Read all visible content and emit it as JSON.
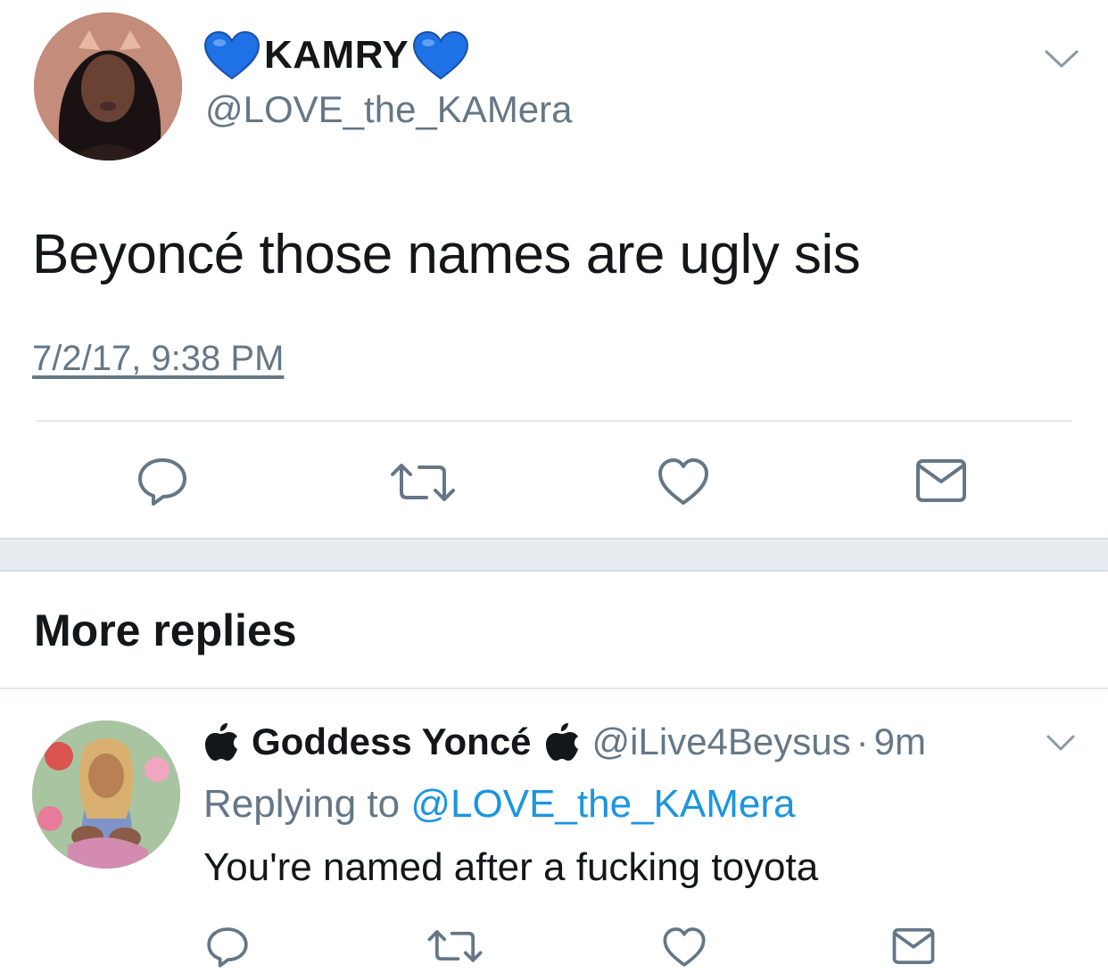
{
  "tweet": {
    "display_name": "KAMRY",
    "handle": "@LOVE_the_KAMera",
    "text": "Beyoncé those names are ugly sis",
    "timestamp": "7/2/17, 9:38 PM"
  },
  "more_replies": {
    "title": "More replies"
  },
  "reply": {
    "display_name": "Goddess Yoncé",
    "handle": "@iLive4Beysus",
    "separator": "·",
    "time_ago": "9m",
    "replying_prefix": "Replying to",
    "replying_to": "@LOVE_the_KAMera",
    "text": "You're named after a fucking toyota"
  },
  "icons": {
    "reply": "reply-icon",
    "retweet": "retweet-icon",
    "like": "like-icon",
    "dm": "direct-message-icon",
    "chevron": "chevron-down-icon",
    "name_emoji": "blue-heart-icon",
    "reply_name_emoji": "apple-logo-icon"
  },
  "colors": {
    "text_primary": "#14171a",
    "text_secondary": "#657786",
    "link": "#1b95e0",
    "heart_blue": "#1e72e6",
    "divider": "#e1e8ed",
    "section_gap": "#e6ecf0"
  }
}
